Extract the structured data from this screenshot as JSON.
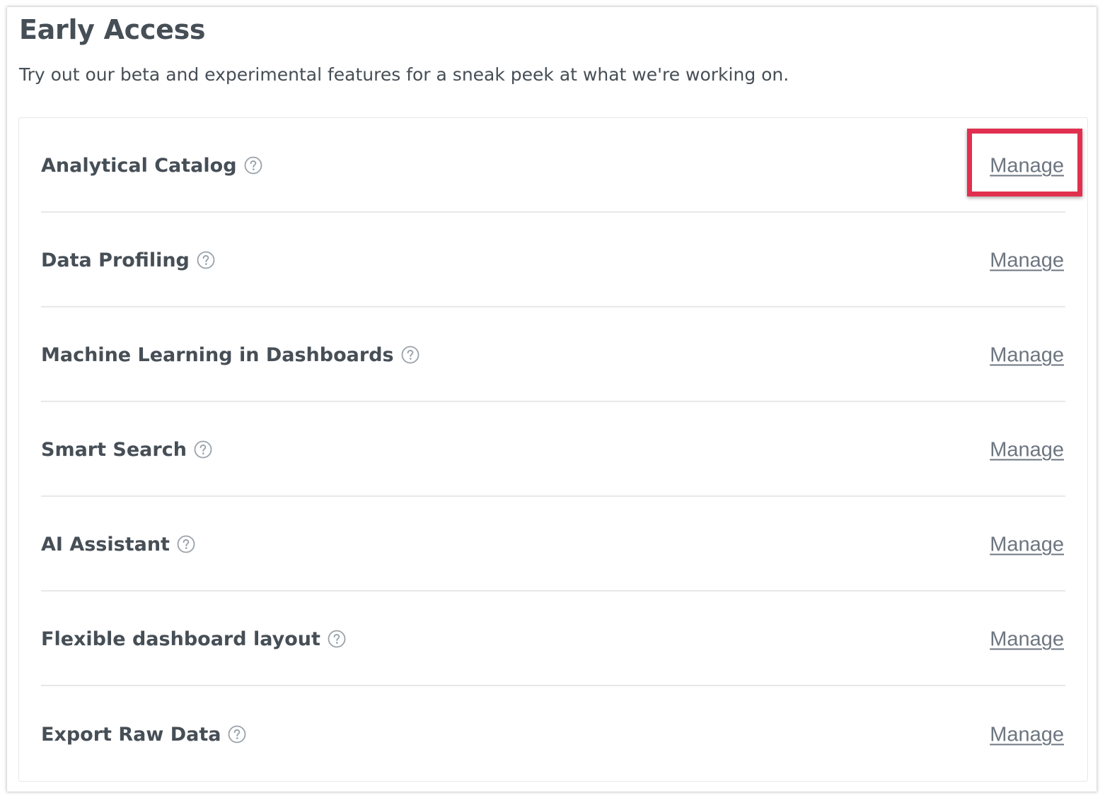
{
  "header": {
    "title": "Early Access",
    "subtitle": "Try out our beta and experimental features for a sneak peek at what we're working on."
  },
  "features": [
    {
      "name": "Analytical Catalog",
      "action": "Manage"
    },
    {
      "name": "Data Profiling",
      "action": "Manage"
    },
    {
      "name": "Machine Learning in Dashboards",
      "action": "Manage"
    },
    {
      "name": "Smart Search",
      "action": "Manage"
    },
    {
      "name": "AI Assistant",
      "action": "Manage"
    },
    {
      "name": "Flexible dashboard layout",
      "action": "Manage"
    },
    {
      "name": "Export Raw Data",
      "action": "Manage"
    }
  ],
  "icons": {
    "help": "help-circle-icon"
  },
  "colors": {
    "text": "#464e56",
    "link": "#6d7680",
    "divider": "#e6e8ea",
    "highlight": "#e1304f"
  }
}
